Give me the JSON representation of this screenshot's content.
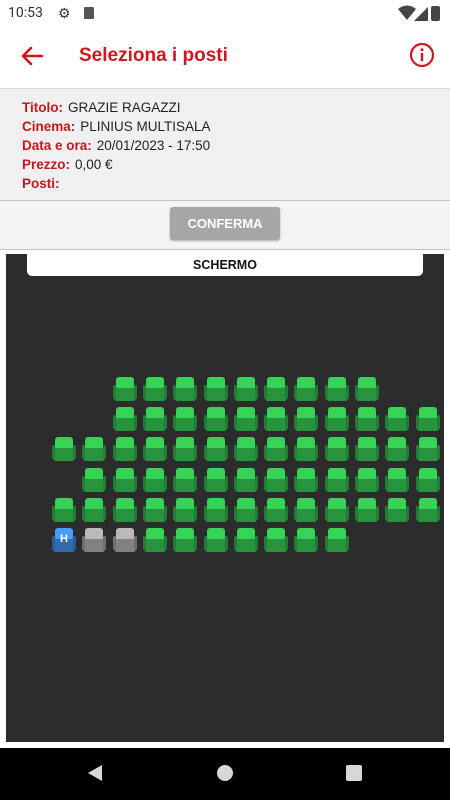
{
  "status_bar": {
    "time": "10:53"
  },
  "app_bar": {
    "title": "Seleziona i posti"
  },
  "details": {
    "titolo_label": "Titolo:",
    "titolo_value": "GRAZIE RAGAZZI",
    "cinema_label": "Cinema:",
    "cinema_value": "PLINIUS MULTISALA",
    "data_label": "Data e ora:",
    "data_value": "20/01/2023 - 17:50",
    "prezzo_label": "Prezzo:",
    "prezzo_value": "0,00 €",
    "posti_label": "Posti:",
    "posti_value": ""
  },
  "confirm_label": "CONFERMA",
  "screen_label": "SCHERMO",
  "colors": {
    "accent": "#d0161e",
    "available": "#2fb34a",
    "occupied": "#9e9e9e",
    "accessible": "#3d84d6"
  },
  "seat_map": {
    "rows": [
      {
        "seats": [
          null,
          null,
          "A",
          "A",
          "A",
          "A",
          "A",
          "A",
          "A",
          "A",
          "A",
          null,
          null
        ]
      },
      {
        "seats": [
          null,
          null,
          "A",
          "A",
          "A",
          "A",
          "A",
          "A",
          "A",
          "A",
          "A",
          "A",
          "A"
        ]
      },
      {
        "seats": [
          "A",
          "A",
          "A",
          "A",
          "A",
          "A",
          "A",
          "A",
          "A",
          "A",
          "A",
          "A",
          "A"
        ]
      },
      {
        "seats": [
          null,
          "A",
          "A",
          "A",
          "A",
          "A",
          "A",
          "A",
          "A",
          "A",
          "A",
          "A",
          "A"
        ]
      },
      {
        "seats": [
          "A",
          "A",
          "A",
          "A",
          "A",
          "A",
          "A",
          "A",
          "A",
          "A",
          "A",
          "A",
          "A"
        ]
      },
      {
        "seats": [
          "H",
          "O",
          "O",
          "A",
          "A",
          "A",
          "A",
          "A",
          "A",
          "A",
          null,
          null,
          null
        ]
      }
    ],
    "accessible_label": "H"
  }
}
